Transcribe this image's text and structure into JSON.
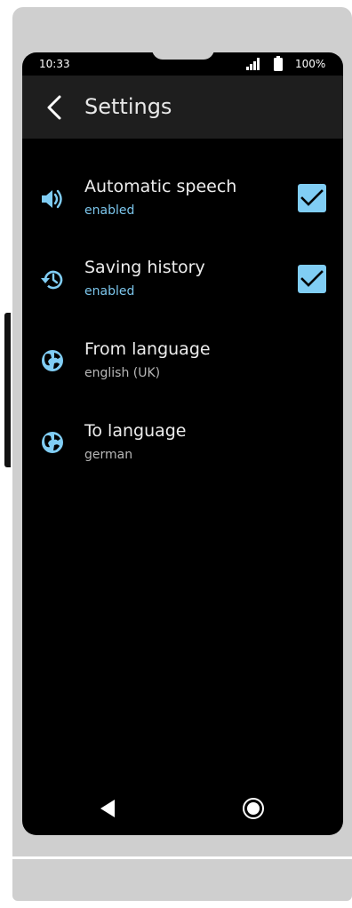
{
  "status_bar": {
    "time": "10:33",
    "battery": "100%",
    "icons": [
      "signal-icon",
      "battery-icon"
    ]
  },
  "header": {
    "title": "Settings",
    "back_icon": "chevron-left-icon"
  },
  "settings": [
    {
      "title": "Automatic speech",
      "subtitle": "enabled",
      "icon": "speaker-icon",
      "checked": true
    },
    {
      "title": "Saving history",
      "subtitle": "enabled",
      "icon": "history-icon",
      "checked": true
    },
    {
      "title": "From language",
      "subtitle": "english (UK)",
      "icon": "globe-icon"
    },
    {
      "title": "To language",
      "subtitle": "german",
      "icon": "globe-icon"
    }
  ],
  "nav": {
    "back_icon": "triangle-back-icon",
    "home_icon": "home-circle-icon"
  },
  "colors": {
    "background": "#000000",
    "app_bar": "#1e1e1e",
    "accent": "#80cdf4",
    "subtitle_accent": "#7cc6ec",
    "subtitle_muted": "#b7b7b7"
  }
}
